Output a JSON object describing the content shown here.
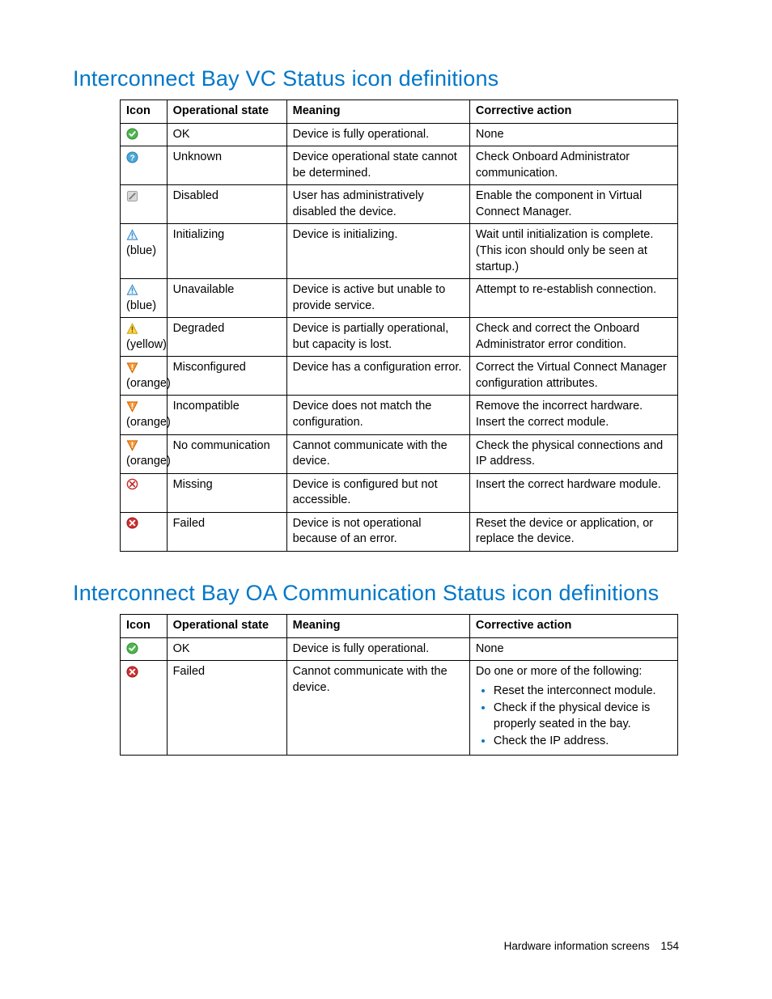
{
  "headings": {
    "vc": "Interconnect Bay VC Status icon definitions",
    "oa": "Interconnect Bay OA Communication Status icon definitions"
  },
  "columns": {
    "icon": "Icon",
    "state": "Operational state",
    "meaning": "Meaning",
    "action": "Corrective action"
  },
  "vc_rows": [
    {
      "icon": "ok",
      "note": "",
      "state": "OK",
      "meaning": "Device is fully operational.",
      "action": "None"
    },
    {
      "icon": "unknown",
      "note": "",
      "state": "Unknown",
      "meaning": "Device operational state cannot be determined.",
      "action": "Check Onboard Administrator communication."
    },
    {
      "icon": "disabled",
      "note": "",
      "state": "Disabled",
      "meaning": "User has administratively disabled the device.",
      "action": "Enable the component in Virtual Connect Manager."
    },
    {
      "icon": "warn-blue",
      "note": "(blue)",
      "state": "Initializing",
      "meaning": "Device is initializing.",
      "action": "Wait until initialization is complete. (This icon should only be seen at startup.)"
    },
    {
      "icon": "warn-blue",
      "note": "(blue)",
      "state": "Unavailable",
      "meaning": "Device is active but unable to provide service.",
      "action": "Attempt to re-establish connection."
    },
    {
      "icon": "warn-yellow",
      "note": "(yellow)",
      "state": "Degraded",
      "meaning": "Device is partially operational, but capacity is lost.",
      "action": "Check and correct the Onboard Administrator error condition."
    },
    {
      "icon": "warn-orange",
      "note": "(orange)",
      "state": "Misconfigured",
      "meaning": "Device has a configuration error.",
      "action": "Correct the Virtual Connect Manager configuration attributes."
    },
    {
      "icon": "warn-orange",
      "note": "(orange)",
      "state": "Incompatible",
      "meaning": "Device does not match the configuration.",
      "action": "Remove the incorrect hardware. Insert the correct module."
    },
    {
      "icon": "warn-orange",
      "note": "(orange)",
      "state": "No communication",
      "meaning": "Cannot communicate with the device.",
      "action": "Check the physical connections and IP address."
    },
    {
      "icon": "missing",
      "note": "",
      "state": "Missing",
      "meaning": "Device is configured but not accessible.",
      "action": "Insert the correct hardware module."
    },
    {
      "icon": "failed",
      "note": "",
      "state": "Failed",
      "meaning": "Device is not operational because of an error.",
      "action": "Reset the device or application, or replace the device."
    }
  ],
  "oa_rows": [
    {
      "icon": "ok",
      "note": "",
      "state": "OK",
      "meaning": "Device is fully operational.",
      "action": "None"
    },
    {
      "icon": "failed",
      "note": "",
      "state": "Failed",
      "meaning": "Cannot communicate with the device.",
      "action_intro": "Do one or more of the following:",
      "action_list": [
        "Reset the interconnect module.",
        "Check if the physical device is properly seated in the bay.",
        "Check the IP address."
      ]
    }
  ],
  "footer": {
    "section": "Hardware information screens",
    "page": "154"
  }
}
